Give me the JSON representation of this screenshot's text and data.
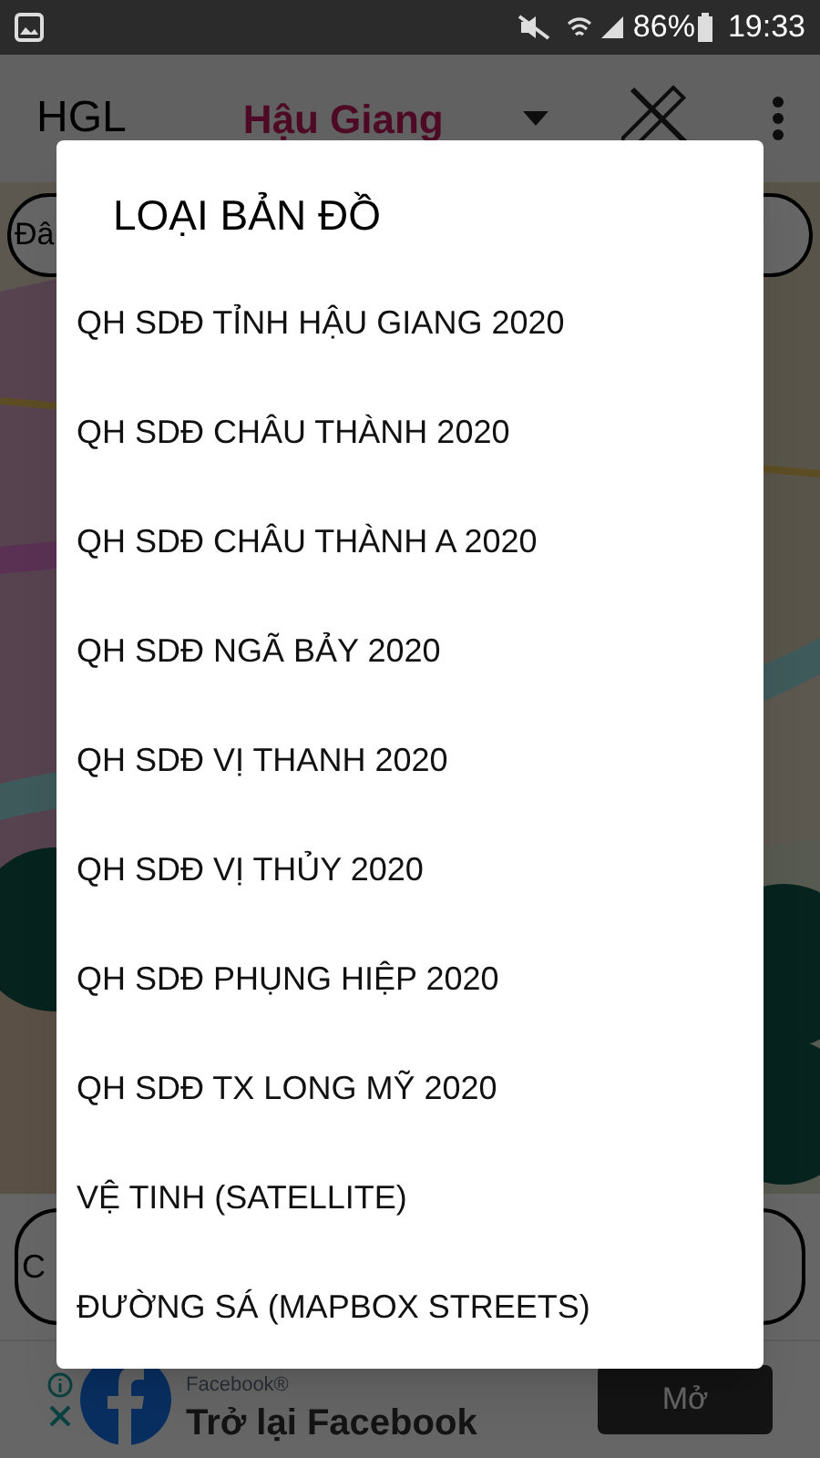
{
  "status_bar": {
    "battery": "86%",
    "time": "19:33"
  },
  "app_bar": {
    "title": "HGL",
    "province": "Hậu Giang"
  },
  "map": {
    "top_pill": "Đâ",
    "bottom_pill": "C"
  },
  "dialog": {
    "title": "LOẠI BẢN ĐỒ",
    "items": [
      {
        "label": "QH SDĐ TỈNH HẬU GIANG 2020"
      },
      {
        "label": "QH SDĐ CHÂU THÀNH 2020"
      },
      {
        "label": "QH SDĐ CHÂU THÀNH A 2020"
      },
      {
        "label": "QH SDĐ NGÃ BẢY 2020"
      },
      {
        "label": "QH SDĐ VỊ THANH 2020"
      },
      {
        "label": "QH SDĐ VỊ THỦY 2020"
      },
      {
        "label": "QH SDĐ PHỤNG HIỆP 2020"
      },
      {
        "label": "QH SDĐ TX LONG MỸ 2020"
      },
      {
        "label": "VỆ TINH (SATELLITE)"
      },
      {
        "label": "ĐƯỜNG SÁ (MAPBOX STREETS)"
      }
    ]
  },
  "ad": {
    "advertiser": "Facebook®",
    "headline": "Trở lại Facebook",
    "button": "Mở"
  }
}
